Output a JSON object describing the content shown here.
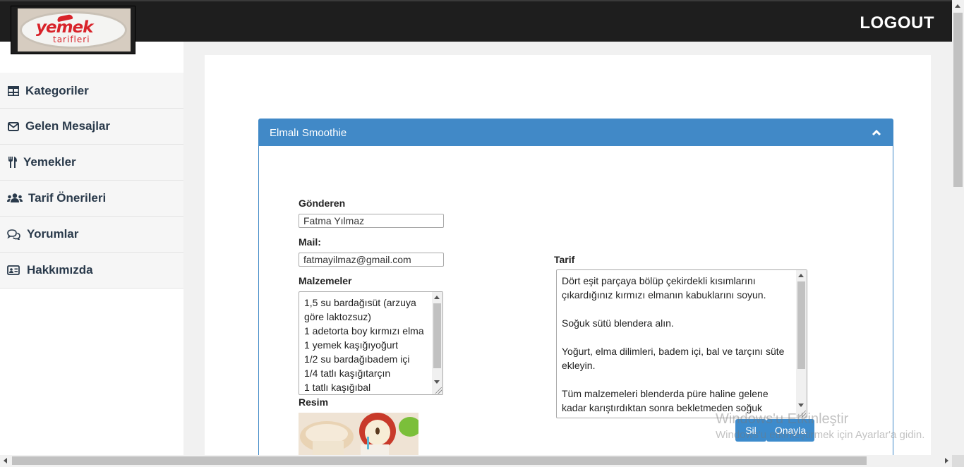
{
  "header": {
    "logo_text": "yemek",
    "logo_subtext": "tarifleri",
    "logout_label": "LOGOUT"
  },
  "sidebar": {
    "items": [
      {
        "label": "Kategoriler",
        "icon": "table-icon"
      },
      {
        "label": "Gelen Mesajlar",
        "icon": "envelope-icon"
      },
      {
        "label": "Yemekler",
        "icon": "utensils-icon"
      },
      {
        "label": "Tarif Önerileri",
        "icon": "users-icon"
      },
      {
        "label": "Yorumlar",
        "icon": "comments-icon"
      },
      {
        "label": "Hakkımızda",
        "icon": "id-card-icon"
      }
    ]
  },
  "panel": {
    "title": "Elmalı Smoothie",
    "sender_label": "Gönderen",
    "sender_value": "Fatma Yılmaz",
    "mail_label": "Mail:",
    "mail_value": "fatmayilmaz@gmail.com",
    "ingredients_label": "Malzemeler",
    "ingredients_value": "1,5 su bardağısüt (arzuya göre laktozsuz)\n1 adetorta boy kırmızı elma\n1 yemek kaşığıyoğurt\n1/2 su bardağıbadem içi\n1/4 tatlı kaşığıtarçın\n1 tatlı kaşığıbal",
    "image_label": "Resim",
    "recipe_label": "Tarif",
    "recipe_value": "Dört eşit parçaya bölüp çekirdekli kısımlarını çıkardığınız kırmızı elmanın kabuklarını soyun.\n\nSoğuk sütü blendera alın.\n\nYoğurt, elma dilimleri, badem içi, bal ve tarçını süte ekleyin.\n\nTüm malzemeleri blenderda püre haline gelene kadar karıştırdıktan sonra bekletmeden soğuk",
    "delete_button": "Sil",
    "approve_button": "Onayla"
  },
  "watermark": {
    "line1": "Windows'u Etkinleştir",
    "line2": "Windows'u etkinleştirmek için Ayarlar'a gidin."
  },
  "colors": {
    "topbar": "#1e1e1e",
    "panel_accent": "#4189c7",
    "sidebar_text": "#2a3a4b"
  }
}
